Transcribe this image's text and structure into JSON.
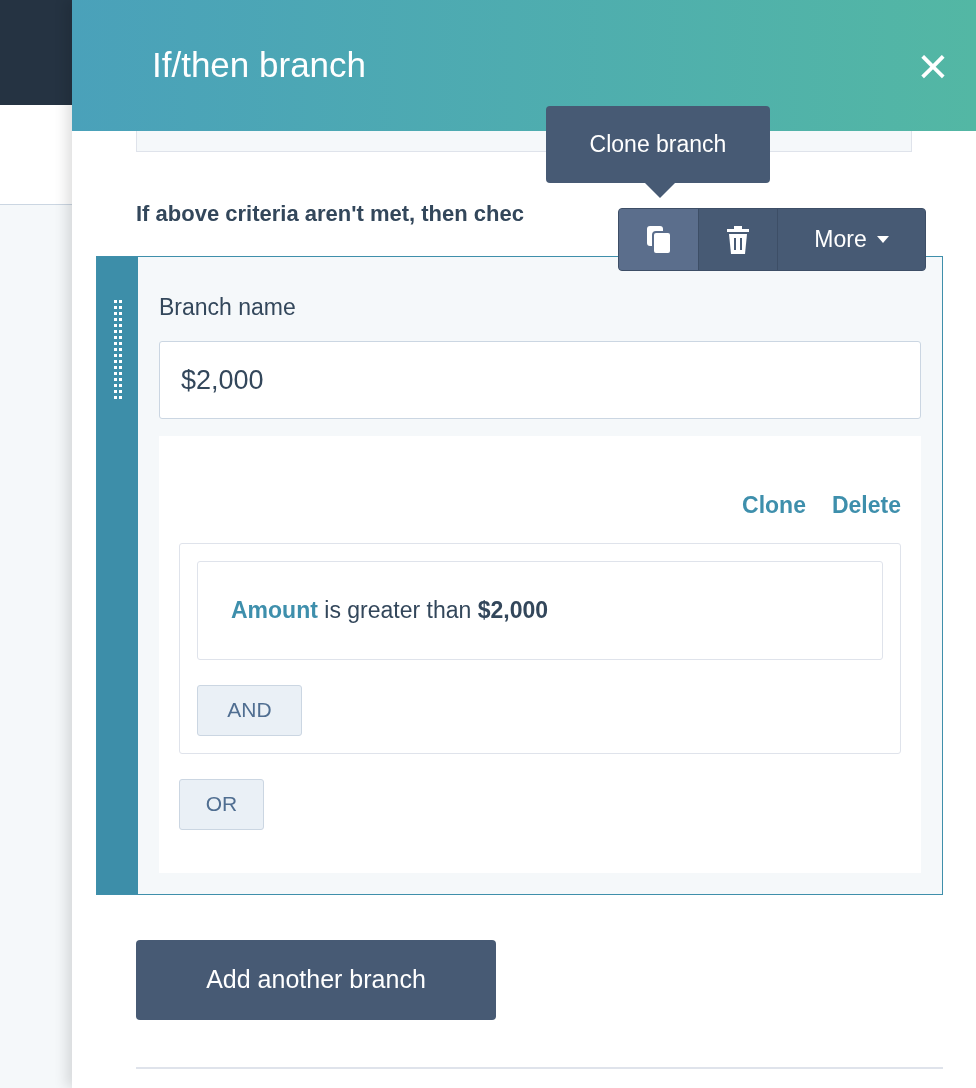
{
  "panel": {
    "title": "If/then branch",
    "close_icon": "×"
  },
  "intro": "If above criteria aren't met, then chec",
  "tooltip": "Clone branch",
  "toolbar": [
    {
      "kind": "clone",
      "active": true
    },
    {
      "kind": "delete",
      "active": false
    },
    {
      "kind": "more",
      "label": "More",
      "active": false
    }
  ],
  "branch": {
    "label": "Branch name",
    "value": "$2,000",
    "actions": [
      "Clone",
      "Delete"
    ],
    "filter": {
      "property": "Amount",
      "text": " is greater than **$2,000**"
    },
    "and_button": "AND",
    "or_button": "OR"
  },
  "add_button": "Add another branch"
}
